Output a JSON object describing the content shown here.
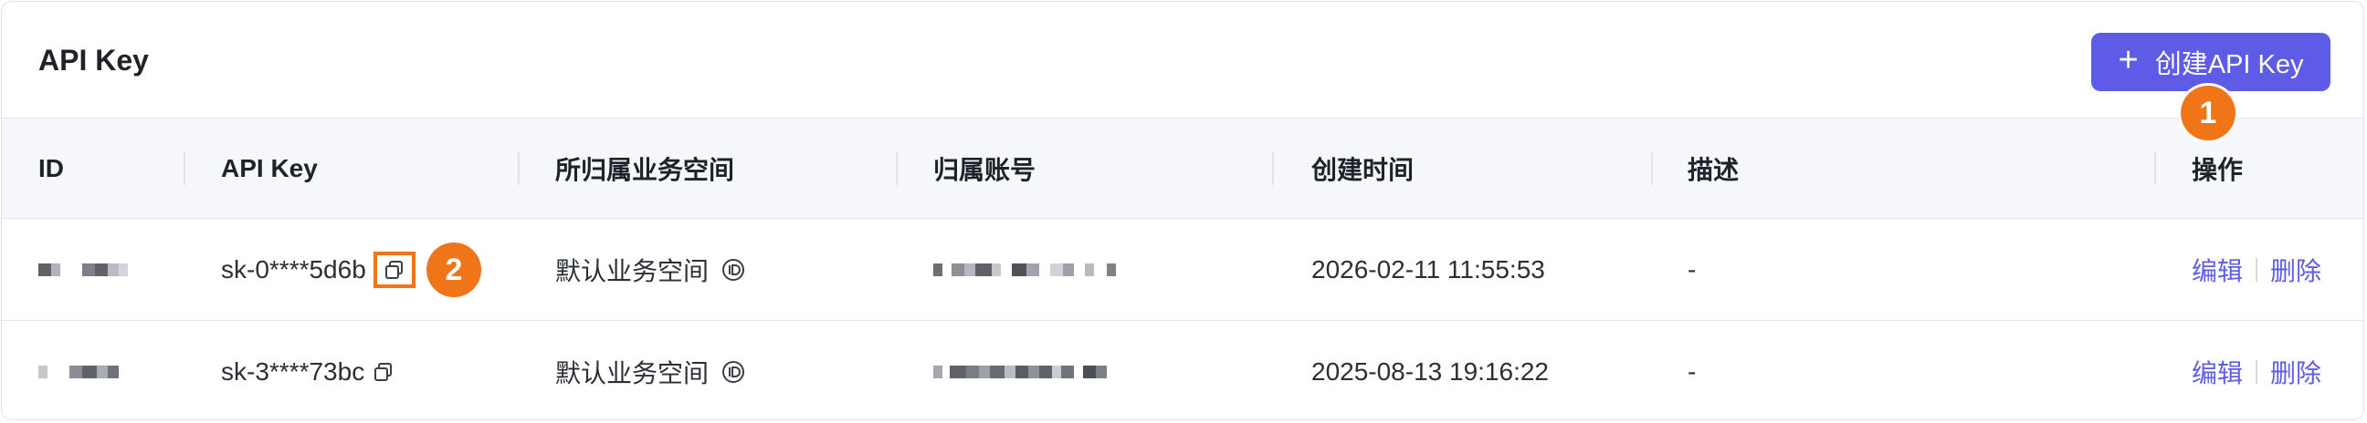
{
  "header": {
    "title": "API Key",
    "create_button": "创建API Key"
  },
  "markers": [
    "1",
    "2"
  ],
  "table": {
    "columns": [
      "ID",
      "API Key",
      "所归属业务空间",
      "归属账号",
      "创建时间",
      "描述",
      "操作"
    ],
    "rows": [
      {
        "id": "",
        "api_key": "sk-0****5d6b",
        "workspace": "默认业务空间",
        "account": "",
        "created_at": "2026-02-11 11:55:53",
        "description": "-",
        "edit": "编辑",
        "delete": "删除"
      },
      {
        "id": "",
        "api_key": "sk-3****73bc",
        "workspace": "默认业务空间",
        "account": "",
        "created_at": "2025-08-13 19:16:22",
        "description": "-",
        "edit": "编辑",
        "delete": "删除"
      }
    ]
  },
  "colors": {
    "accent": "#5e5ce6",
    "marker": "#f07418",
    "header_bg": "#f6f7fa"
  },
  "icons": [
    "plus-icon",
    "copy-icon",
    "id-icon"
  ]
}
